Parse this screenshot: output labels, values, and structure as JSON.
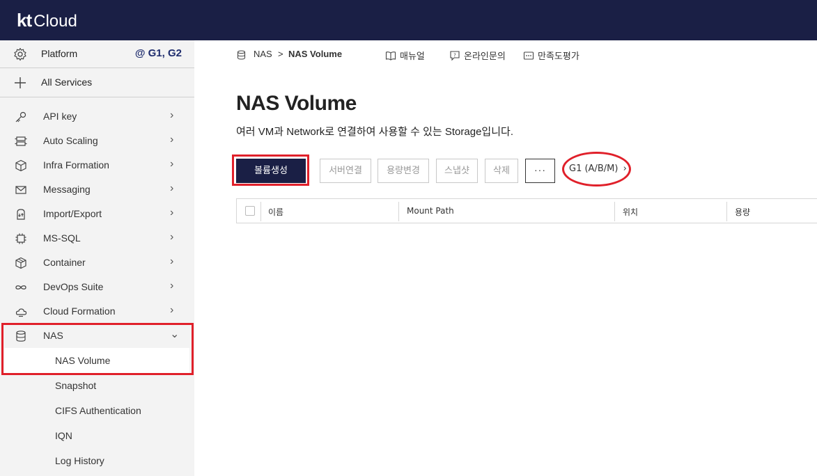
{
  "header": {
    "logo_kt": "kt",
    "logo_cloud": "Cloud"
  },
  "sidebar": {
    "platform": {
      "label": "Platform",
      "region": "@ G1, G2",
      "icon": "gear-icon"
    },
    "all_services": {
      "label": "All Services",
      "icon": "plus-icon"
    },
    "menu": [
      {
        "label": "API key",
        "icon": "key-icon"
      },
      {
        "label": "Auto Scaling",
        "icon": "servers-icon"
      },
      {
        "label": "Infra Formation",
        "icon": "cube-icon"
      },
      {
        "label": "Messaging",
        "icon": "envelope-icon"
      },
      {
        "label": "Import/Export",
        "icon": "import-export-icon"
      },
      {
        "label": "MS-SQL",
        "icon": "chip-icon"
      },
      {
        "label": "Container",
        "icon": "container-icon"
      },
      {
        "label": "DevOps Suite",
        "icon": "infinity-icon"
      },
      {
        "label": "Cloud Formation",
        "icon": "cloud-icon"
      },
      {
        "label": "NAS",
        "icon": "database-icon",
        "expanded": true
      }
    ],
    "nas_submenu": [
      {
        "label": "NAS Volume",
        "active": true
      },
      {
        "label": "Snapshot"
      },
      {
        "label": "CIFS Authentication"
      },
      {
        "label": "IQN"
      },
      {
        "label": "Log History"
      }
    ],
    "chevron_right": "›",
    "chevron_down": "⌄"
  },
  "breadcrumb": {
    "parent": "NAS",
    "separator": ">",
    "current": "NAS Volume"
  },
  "top_links": {
    "manual": "매뉴얼",
    "inquiry": "온라인문의",
    "survey": "만족도평가"
  },
  "page": {
    "title": "NAS Volume",
    "description": "여러 VM과 Network로 연결하여 사용할 수 있는 Storage입니다."
  },
  "toolbar": {
    "create": "볼륨생성",
    "connect": "서버연결",
    "resize": "용량변경",
    "snapshot": "스냅샷",
    "delete": "삭제",
    "more": "···",
    "region": "G1 (A/B/M)",
    "region_chevron": "›"
  },
  "table": {
    "columns": [
      "이름",
      "Mount Path",
      "위치",
      "용량"
    ]
  },
  "colors": {
    "navy": "#1a1f45",
    "highlight": "#e0202a",
    "region_text": "#1f2d6e"
  }
}
